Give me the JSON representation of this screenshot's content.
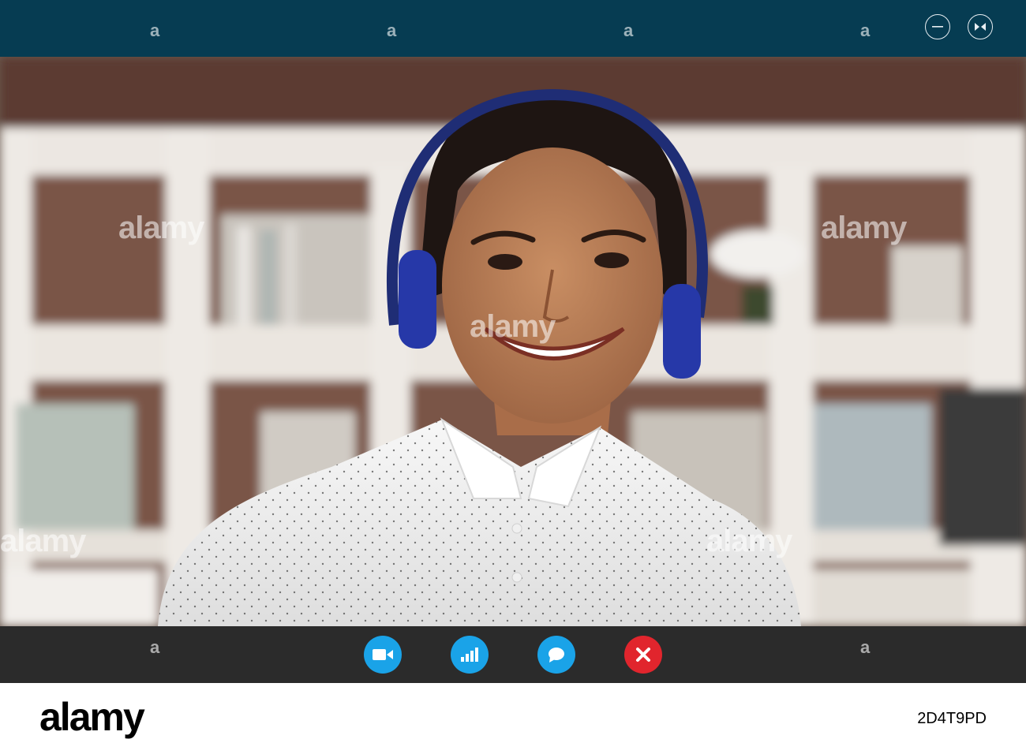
{
  "window": {
    "minimize_icon": "minimize-icon",
    "restore_icon": "collapse-icon"
  },
  "video": {
    "subject": "woman-with-headphones",
    "watermark_text": "alamy",
    "watermark_mark": "a"
  },
  "controls": [
    {
      "name": "video-camera-button",
      "icon": "video-camera-icon",
      "color": "#1aa3e8"
    },
    {
      "name": "signal-stats-button",
      "icon": "signal-bars-icon",
      "color": "#1aa3e8"
    },
    {
      "name": "chat-button",
      "icon": "chat-bubble-icon",
      "color": "#1aa3e8"
    },
    {
      "name": "end-call-button",
      "icon": "close-icon",
      "color": "#e1252d"
    }
  ],
  "footer": {
    "logo": "alamy",
    "image_id": "2D4T9PD"
  },
  "colors": {
    "titlebar": "#063c52",
    "controlbar": "#2b2b2b",
    "accent_blue": "#1aa3e8",
    "end_red": "#e1252d"
  }
}
